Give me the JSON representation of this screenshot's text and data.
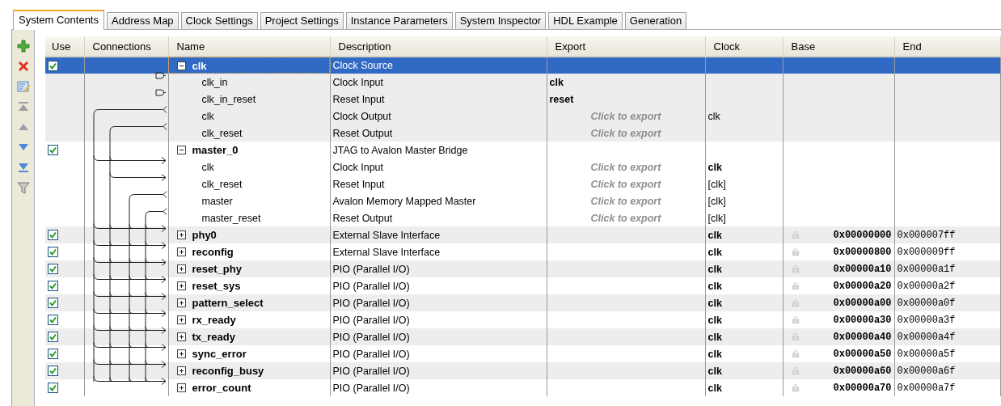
{
  "tabs": [
    {
      "label": "System Contents",
      "selected": true
    },
    {
      "label": "Address Map",
      "selected": false
    },
    {
      "label": "Clock Settings",
      "selected": false
    },
    {
      "label": "Project Settings",
      "selected": false
    },
    {
      "label": "Instance Parameters",
      "selected": false
    },
    {
      "label": "System Inspector",
      "selected": false
    },
    {
      "label": "HDL Example",
      "selected": false
    },
    {
      "label": "Generation",
      "selected": false
    }
  ],
  "toolbar": [
    {
      "kind": "add"
    },
    {
      "kind": "remove"
    },
    {
      "kind": "edit"
    },
    {
      "kind": "top"
    },
    {
      "kind": "up"
    },
    {
      "kind": "down"
    },
    {
      "kind": "bottom"
    },
    {
      "kind": "filter"
    }
  ],
  "table": {
    "columns": [
      "Use",
      "Connections",
      "Name",
      "Description",
      "Export",
      "Clock",
      "Base",
      "End"
    ],
    "modules": [
      {
        "name": "clk",
        "description": "Clock Source",
        "use": true,
        "expanded": true,
        "selected": true,
        "children": [
          {
            "name": "clk_in",
            "description": "Clock Input",
            "kind": "export",
            "export": {
              "text": "clk",
              "kind": "exported"
            }
          },
          {
            "name": "clk_in_reset",
            "description": "Reset Input",
            "kind": "export",
            "export": {
              "text": "reset",
              "kind": "exported"
            }
          },
          {
            "name": "clk",
            "description": "Clock Output",
            "kind": "source",
            "export": {
              "text": "Click to export",
              "kind": "placeholder"
            },
            "clock": {
              "text": "clk",
              "bold": false
            }
          },
          {
            "name": "clk_reset",
            "description": "Reset Output",
            "kind": "source",
            "export": {
              "text": "Click to export",
              "kind": "placeholder"
            }
          }
        ]
      },
      {
        "name": "master_0",
        "description": "JTAG to Avalon Master Bridge",
        "use": true,
        "expanded": true,
        "selected": false,
        "children": [
          {
            "name": "clk",
            "description": "Clock Input",
            "kind": "sink",
            "export": {
              "text": "Click to export",
              "kind": "placeholder"
            },
            "clock": {
              "text": "clk",
              "bold": true
            }
          },
          {
            "name": "clk_reset",
            "description": "Reset Input",
            "kind": "sink",
            "export": {
              "text": "Click to export",
              "kind": "placeholder"
            },
            "clock": {
              "text": "[clk]",
              "bold": false
            }
          },
          {
            "name": "master",
            "description": "Avalon Memory Mapped Master",
            "kind": "source",
            "export": {
              "text": "Click to export",
              "kind": "placeholder"
            },
            "clock": {
              "text": "[clk]",
              "bold": false
            }
          },
          {
            "name": "master_reset",
            "description": "Reset Output",
            "kind": "source",
            "export": {
              "text": "Click to export",
              "kind": "placeholder"
            },
            "clock": {
              "text": "[clk]",
              "bold": false
            }
          }
        ]
      },
      {
        "name": "phy0",
        "description": "External Slave Interface",
        "use": true,
        "expanded": false,
        "selected": false,
        "kind": "sink",
        "clock": {
          "text": "clk",
          "bold": true
        },
        "base": "0x00000000",
        "end": "0x000007ff"
      },
      {
        "name": "reconfig",
        "description": "External Slave Interface",
        "use": true,
        "expanded": false,
        "selected": false,
        "kind": "sink",
        "clock": {
          "text": "clk",
          "bold": true
        },
        "base": "0x00000800",
        "end": "0x000009ff"
      },
      {
        "name": "reset_phy",
        "description": "PIO (Parallel I/O)",
        "use": true,
        "expanded": false,
        "selected": false,
        "kind": "sink",
        "clock": {
          "text": "clk",
          "bold": true
        },
        "base": "0x00000a10",
        "end": "0x00000a1f"
      },
      {
        "name": "reset_sys",
        "description": "PIO (Parallel I/O)",
        "use": true,
        "expanded": false,
        "selected": false,
        "kind": "sink",
        "clock": {
          "text": "clk",
          "bold": true
        },
        "base": "0x00000a20",
        "end": "0x00000a2f"
      },
      {
        "name": "pattern_select",
        "description": "PIO (Parallel I/O)",
        "use": true,
        "expanded": false,
        "selected": false,
        "kind": "sink",
        "clock": {
          "text": "clk",
          "bold": true
        },
        "base": "0x00000a00",
        "end": "0x00000a0f"
      },
      {
        "name": "rx_ready",
        "description": "PIO (Parallel I/O)",
        "use": true,
        "expanded": false,
        "selected": false,
        "kind": "sink",
        "clock": {
          "text": "clk",
          "bold": true
        },
        "base": "0x00000a30",
        "end": "0x00000a3f"
      },
      {
        "name": "tx_ready",
        "description": "PIO (Parallel I/O)",
        "use": true,
        "expanded": false,
        "selected": false,
        "kind": "sink",
        "clock": {
          "text": "clk",
          "bold": true
        },
        "base": "0x00000a40",
        "end": "0x00000a4f"
      },
      {
        "name": "sync_error",
        "description": "PIO (Parallel I/O)",
        "use": true,
        "expanded": false,
        "selected": false,
        "kind": "sink",
        "clock": {
          "text": "clk",
          "bold": true
        },
        "base": "0x00000a50",
        "end": "0x00000a5f"
      },
      {
        "name": "reconfig_busy",
        "description": "PIO (Parallel I/O)",
        "use": true,
        "expanded": false,
        "selected": false,
        "kind": "sink",
        "clock": {
          "text": "clk",
          "bold": true
        },
        "base": "0x00000a60",
        "end": "0x00000a6f"
      },
      {
        "name": "error_count",
        "description": "PIO (Parallel I/O)",
        "use": true,
        "expanded": false,
        "selected": false,
        "kind": "sink",
        "clock": {
          "text": "clk",
          "bold": true
        },
        "base": "0x00000a70",
        "end": "0x00000a7f"
      }
    ]
  }
}
